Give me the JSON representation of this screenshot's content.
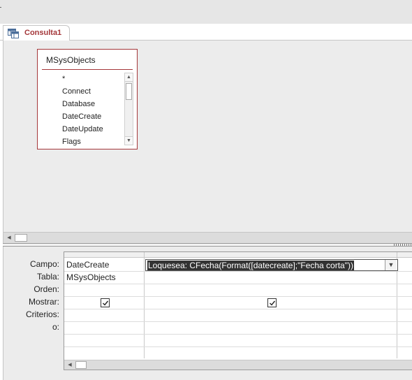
{
  "document_tab": {
    "title": "Consulta1",
    "icon": "query-icon"
  },
  "table_box": {
    "name": "MSysObjects",
    "fields": [
      "*",
      "Connect",
      "Database",
      "DateCreate",
      "DateUpdate",
      "Flags"
    ]
  },
  "design_grid": {
    "row_labels": [
      "Campo:",
      "Tabla:",
      "Orden:",
      "Mostrar:",
      "Criterios:",
      "o:"
    ],
    "column1": {
      "field": "DateCreate",
      "table": "MSysObjects",
      "show": true
    },
    "column2": {
      "field": "Loquesea: CFecha(Format([datecreate];\"Fecha corta\"))",
      "table": "",
      "show": true
    }
  },
  "colors": {
    "accent": "#a4373a",
    "pane_background": "#ececec",
    "selection": "#333333"
  }
}
